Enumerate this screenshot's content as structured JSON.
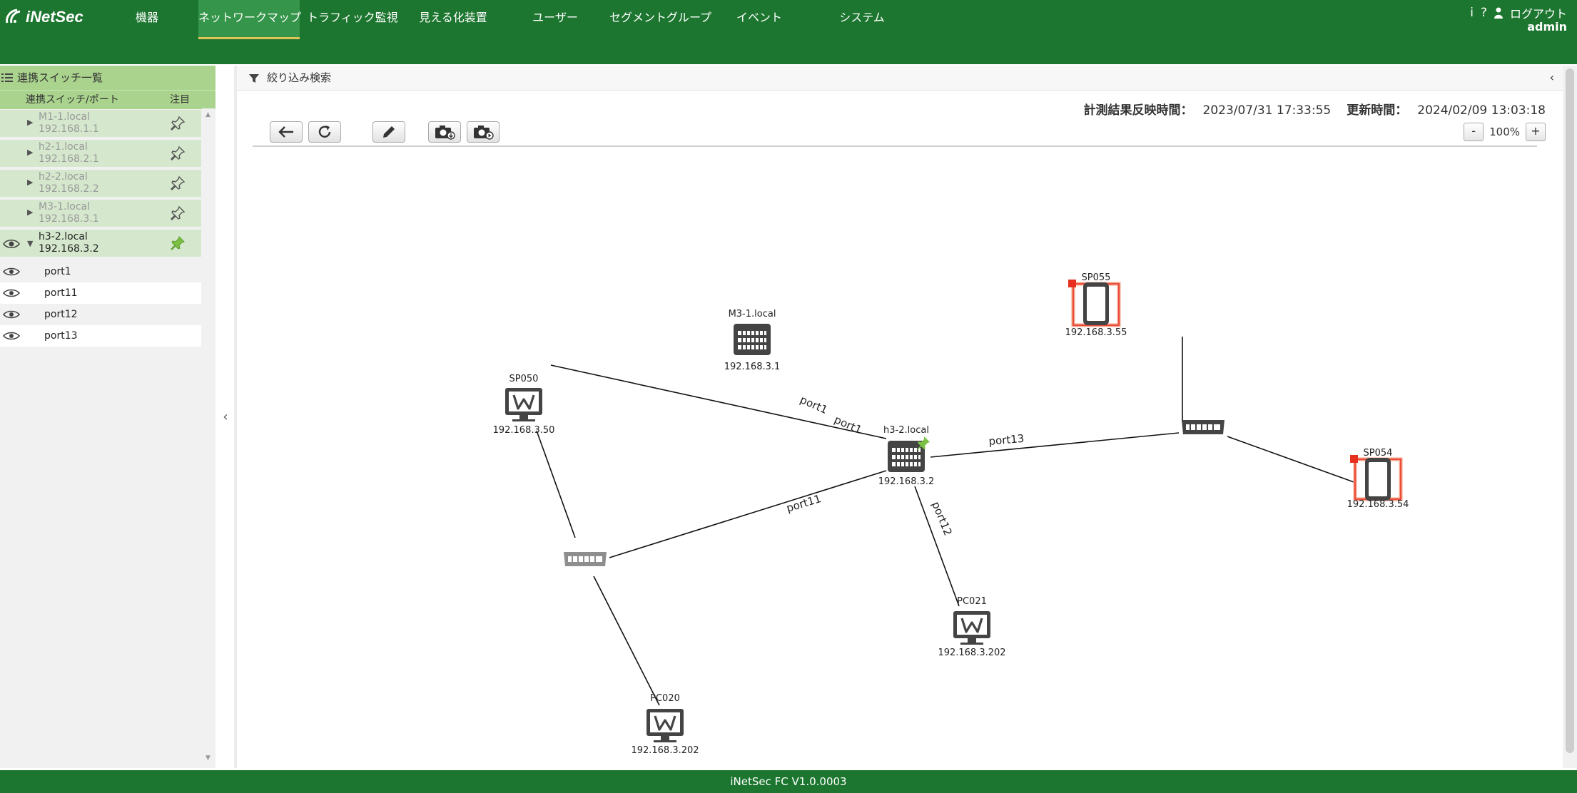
{
  "app": {
    "logo_text": "iNetSec",
    "footer": "iNetSec FC V1.0.0003"
  },
  "nav": {
    "items": [
      {
        "label": "機器"
      },
      {
        "label": "ネットワークマップ"
      },
      {
        "label": "トラフィック監視"
      },
      {
        "label": "見える化装置"
      },
      {
        "label": "ユーザー"
      },
      {
        "label": "セグメントグループ"
      },
      {
        "label": "イベント"
      },
      {
        "label": "システム"
      }
    ],
    "active_index": 1
  },
  "header": {
    "info_icon": "i",
    "help_icon": "?",
    "logout_label": "ログアウト",
    "user": "admin"
  },
  "sidebar": {
    "title": "連携スイッチ一覧",
    "col_switch": "連携スイッチ/ポート",
    "col_watch": "注目",
    "switches": [
      {
        "name": "M1-1.local",
        "ip": "192.168.1.1",
        "pinned": false,
        "expanded": false
      },
      {
        "name": "h2-1.local",
        "ip": "192.168.2.1",
        "pinned": false,
        "expanded": false
      },
      {
        "name": "h2-2.local",
        "ip": "192.168.2.2",
        "pinned": false,
        "expanded": false
      },
      {
        "name": "M3-1.local",
        "ip": "192.168.3.1",
        "pinned": false,
        "expanded": false
      },
      {
        "name": "h3-2.local",
        "ip": "192.168.3.2",
        "pinned": true,
        "expanded": true
      }
    ],
    "ports": [
      "port1",
      "port11",
      "port12",
      "port13"
    ]
  },
  "main": {
    "filter_label": "絞り込み検索",
    "measure_label": "計測結果反映時間：",
    "measure_time": "2023/07/31 17:33:55",
    "update_label": "更新時間：",
    "update_time": "2024/02/09 13:03:18",
    "zoom_minus": "-",
    "zoom_level": "100%",
    "zoom_plus": "+"
  },
  "map": {
    "nodes": {
      "m31": {
        "name": "M3-1.local",
        "ip": "192.168.3.1"
      },
      "h32": {
        "name": "h3-2.local",
        "ip": "192.168.3.2"
      },
      "sp050": {
        "name": "SP050",
        "ip": "192.168.3.50"
      },
      "pc020": {
        "name": "PC020",
        "ip": "192.168.3.202"
      },
      "pc021": {
        "name": "PC021",
        "ip": "192.168.3.202"
      },
      "sp055": {
        "name": "SP055",
        "ip": "192.168.3.55"
      },
      "sp054": {
        "name": "SP054",
        "ip": "192.168.3.54"
      }
    },
    "links": {
      "m31_port": "port1",
      "h32_port1": "port1",
      "h32_port11": "port11",
      "h32_port12": "port12",
      "h32_port13": "port13"
    },
    "colors": {
      "alert": "#e8301f",
      "alert_glow": "#f4a48c",
      "pin": "#7bc043"
    }
  }
}
